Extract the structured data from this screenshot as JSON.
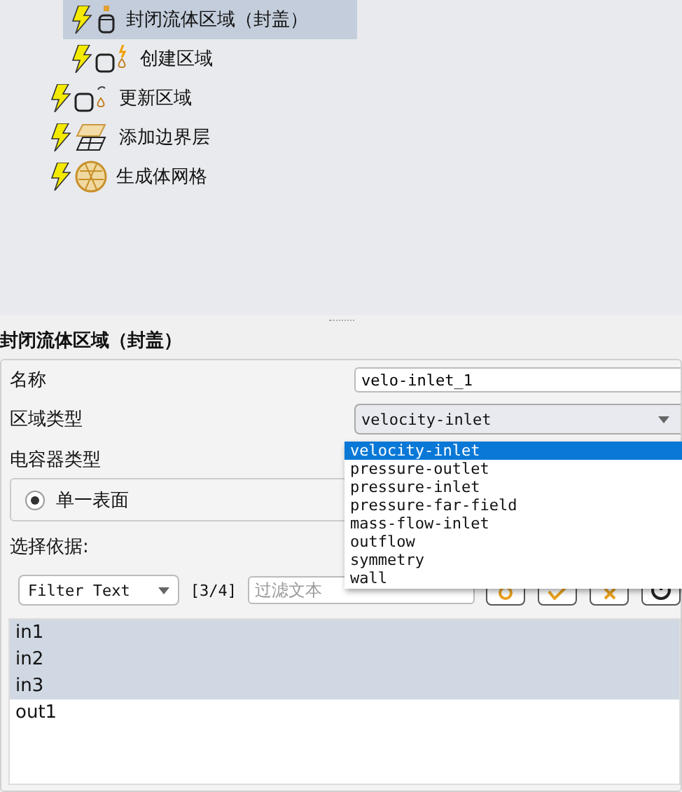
{
  "tree": [
    {
      "children": [
        {
          "label": "封闭流体区域（封盖）",
          "kind": "cap",
          "selected": true
        },
        {
          "label": "创建区域",
          "kind": "create",
          "selected": false
        }
      ]
    },
    {
      "label": "更新区域",
      "kind": "update",
      "selected": false
    },
    {
      "label": "添加边界层",
      "kind": "layers",
      "selected": false
    },
    {
      "label": "生成体网格",
      "kind": "mesh",
      "selected": false
    }
  ],
  "panel": {
    "title": "封闭流体区域（封盖）",
    "name_label": "名称",
    "name_value": "velo-inlet_1",
    "zone_type_label": "区域类型",
    "zone_type_value": "velocity-inlet",
    "zone_type_options": [
      {
        "label": "velocity-inlet",
        "selected": true
      },
      {
        "label": "pressure-outlet",
        "selected": false
      },
      {
        "label": "pressure-inlet",
        "selected": false
      },
      {
        "label": "pressure-far-field",
        "selected": false
      },
      {
        "label": "mass-flow-inlet",
        "selected": false
      },
      {
        "label": "outflow",
        "selected": false
      },
      {
        "label": "symmetry",
        "selected": false
      },
      {
        "label": "wall",
        "selected": false
      }
    ],
    "capacitor_label": "电容器类型",
    "radios": [
      {
        "label": "单一表面",
        "selected": true
      }
    ],
    "select_by_label": "选择依据:",
    "filter_mode": "Filter Text",
    "count": "[3/4]",
    "filter_placeholder": "过滤文本",
    "tool_buttons": [
      {
        "kind": "circle"
      },
      {
        "kind": "check"
      },
      {
        "kind": "cross"
      },
      {
        "kind": "ring"
      }
    ],
    "items": [
      {
        "label": "in1",
        "selected": true
      },
      {
        "label": "in2",
        "selected": true
      },
      {
        "label": "in3",
        "selected": true
      },
      {
        "label": "out1",
        "selected": false
      }
    ]
  }
}
